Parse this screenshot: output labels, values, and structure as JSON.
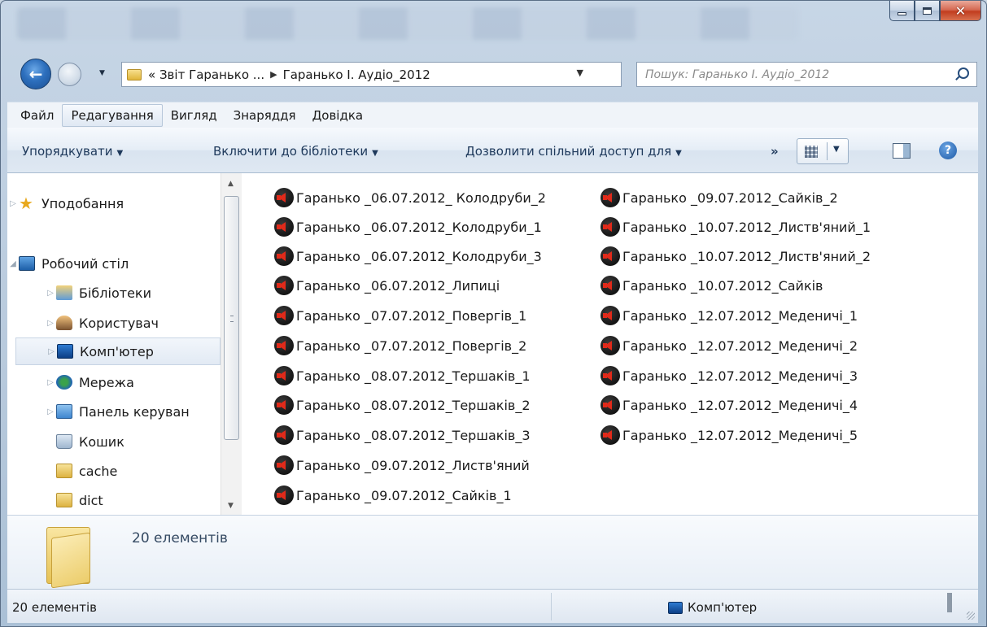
{
  "window": {
    "caption_buttons": {
      "minimize": "minimize-icon",
      "maximize": "maximize-icon",
      "close": "✕"
    }
  },
  "address_bar": {
    "crumbs": [
      "« Звіт Гаранько ...",
      "Гаранько І. Аудіо_2012"
    ],
    "search_placeholder": "Пошук: Гаранько І. Аудіо_2012"
  },
  "menu": [
    "Файл",
    "Редагування",
    "Вигляд",
    "Знаряддя",
    "Довідка"
  ],
  "toolbar": {
    "organize": "Упорядкувати",
    "include_library": "Включити до бібліотеки",
    "share_with": "Дозволити спільний доступ для",
    "more": "»"
  },
  "nav_pane": [
    {
      "label": "Уподобання",
      "icon": "star-icon"
    },
    {
      "label": "Робочий стіл",
      "icon": "desktop-icon"
    },
    {
      "label": "Бібліотеки",
      "icon": "libraries-icon"
    },
    {
      "label": "Користувач",
      "icon": "user-icon"
    },
    {
      "label": "Комп'ютер",
      "icon": "computer-icon"
    },
    {
      "label": "Мережа",
      "icon": "network-icon"
    },
    {
      "label": "Панель керуван",
      "icon": "control-panel-icon"
    },
    {
      "label": "Кошик",
      "icon": "recycle-bin-icon"
    },
    {
      "label": "cache",
      "icon": "folder-icon"
    },
    {
      "label": "dict",
      "icon": "folder-icon"
    }
  ],
  "files": [
    "Гаранько _06.07.2012_ Колодруби_2",
    "Гаранько _06.07.2012_Колодруби_1",
    "Гаранько _06.07.2012_Колодруби_3",
    "Гаранько _06.07.2012_Липиці",
    "Гаранько _07.07.2012_Повергів_1",
    "Гаранько _07.07.2012_Повергів_2",
    "Гаранько _08.07.2012_Тершаків_1",
    "Гаранько _08.07.2012_Тершаків_2",
    "Гаранько _08.07.2012_Тершаків_3",
    "Гаранько _09.07.2012_Листв'яний",
    "Гаранько _09.07.2012_Сайків_1",
    "Гаранько _09.07.2012_Сайків_2",
    "Гаранько _10.07.2012_Листв'яний_1",
    "Гаранько _10.07.2012_Листв'яний_2",
    "Гаранько _10.07.2012_Сайків",
    "Гаранько _12.07.2012_Меденичі_1",
    "Гаранько _12.07.2012_Меденичі_2",
    "Гаранько _12.07.2012_Меденичі_3",
    "Гаранько _12.07.2012_Меденичі_4",
    "Гаранько _12.07.2012_Меденичі_5"
  ],
  "details": {
    "count": "20 елементів"
  },
  "status": {
    "left": "20 елементів",
    "location": "Комп'ютер"
  }
}
